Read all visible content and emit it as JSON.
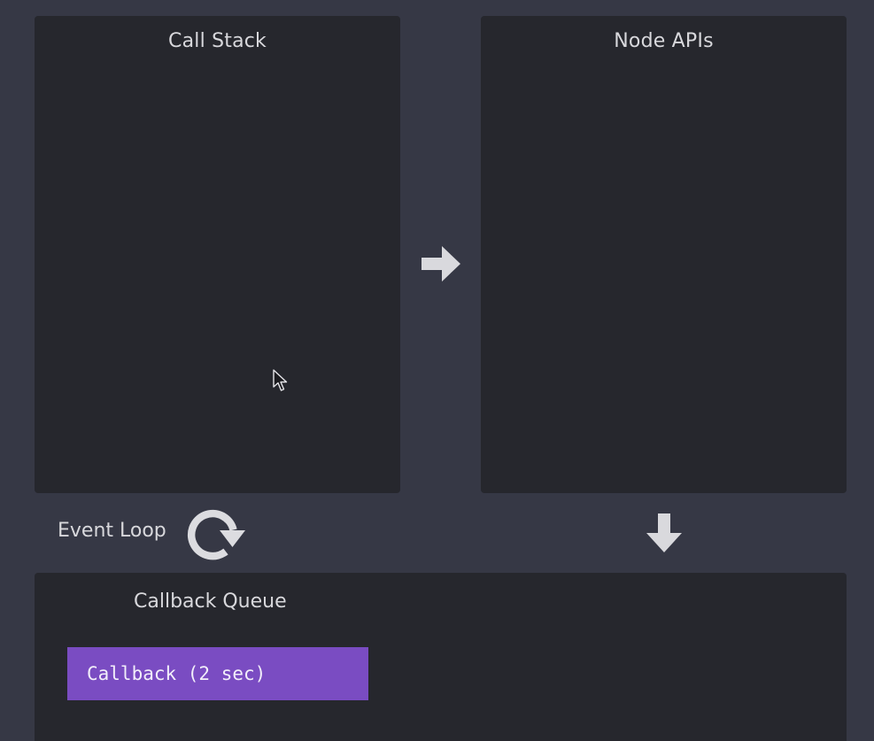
{
  "panels": {
    "call_stack": {
      "title": "Call Stack"
    },
    "node_apis": {
      "title": "Node APIs"
    },
    "callback_queue": {
      "title": "Callback Queue",
      "items": [
        {
          "label": "Callback (2 sec)"
        }
      ]
    }
  },
  "event_loop": {
    "label": "Event Loop"
  },
  "icons": {
    "flow_right": "arrow-right-icon",
    "flow_down": "arrow-down-icon",
    "event_loop": "refresh-icon",
    "pointer": "cursor-icon"
  },
  "colors": {
    "background": "#363845",
    "panel": "#26272d",
    "text": "#d8d8dc",
    "callback_item": "#7a4cc2",
    "arrow": "#d9d9dd"
  }
}
